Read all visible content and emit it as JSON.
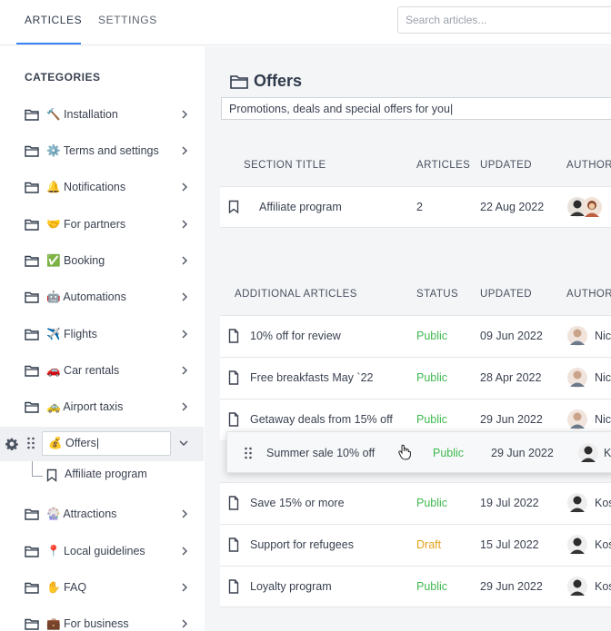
{
  "tabs": {
    "articles": "ARTICLES",
    "settings": "SETTINGS"
  },
  "search": {
    "placeholder": "Search articles..."
  },
  "sidebar": {
    "title": "CATEGORIES",
    "items": [
      {
        "label": "🔨 Installation"
      },
      {
        "label": "⚙️ Terms and settings"
      },
      {
        "label": "🔔 Notifications"
      },
      {
        "label": "🤝 For partners"
      },
      {
        "label": "✅ Booking"
      },
      {
        "label": "🤖 Automations"
      },
      {
        "label": "✈️ Flights"
      },
      {
        "label": "🚗 Car rentals"
      },
      {
        "label": "🚕 Airport taxis"
      },
      {
        "label": "🎡 Attractions"
      },
      {
        "label": "📍 Local guidelines"
      },
      {
        "label": "✋ FAQ"
      },
      {
        "label": "💼 For business"
      }
    ],
    "active": {
      "label": "💰 Offers|",
      "sub_item": "Affiliate program"
    }
  },
  "main": {
    "title": "Offers",
    "description": "Promotions, deals and special offers for you|",
    "sections_table": {
      "headers": {
        "title": "SECTION TITLE",
        "articles": "ARTICLES",
        "updated": "UPDATED",
        "authors": "AUTHORS"
      },
      "rows": [
        {
          "title": "Affiliate program",
          "articles": "2",
          "updated": "22 Aug 2022"
        }
      ]
    },
    "articles_table": {
      "headers": {
        "title": "ADDITIONAL ARTICLES",
        "status": "STATUS",
        "updated": "UPDATED",
        "author": "AUTHOR"
      },
      "rows": [
        {
          "title": "10% off for review",
          "status": "Public",
          "updated": "09 Jun 2022",
          "author": "Nic"
        },
        {
          "title": "Free breakfasts May `22",
          "status": "Public",
          "updated": "28 Apr 2022",
          "author": "Nic"
        },
        {
          "title": "Getaway deals from 15% off",
          "status": "Public",
          "updated": "29 Jun 2022",
          "author": "Nic"
        },
        {
          "title": "Save 15% or more",
          "status": "Public",
          "updated": "19 Jul 2022",
          "author": "Kos"
        },
        {
          "title": "Support for refugees",
          "status": "Draft",
          "updated": "15 Jul 2022",
          "author": "Kos"
        },
        {
          "title": "Loyalty program",
          "status": "Public",
          "updated": "29 Jun 2022",
          "author": "Kos"
        }
      ],
      "dragging": {
        "title": "Summer sale 10% off",
        "status": "Public",
        "updated": "29 Jun 2022",
        "author": "K"
      }
    }
  },
  "colors": {
    "accent": "#3b82f6",
    "public": "#3fb950",
    "draft": "#e3a018"
  }
}
